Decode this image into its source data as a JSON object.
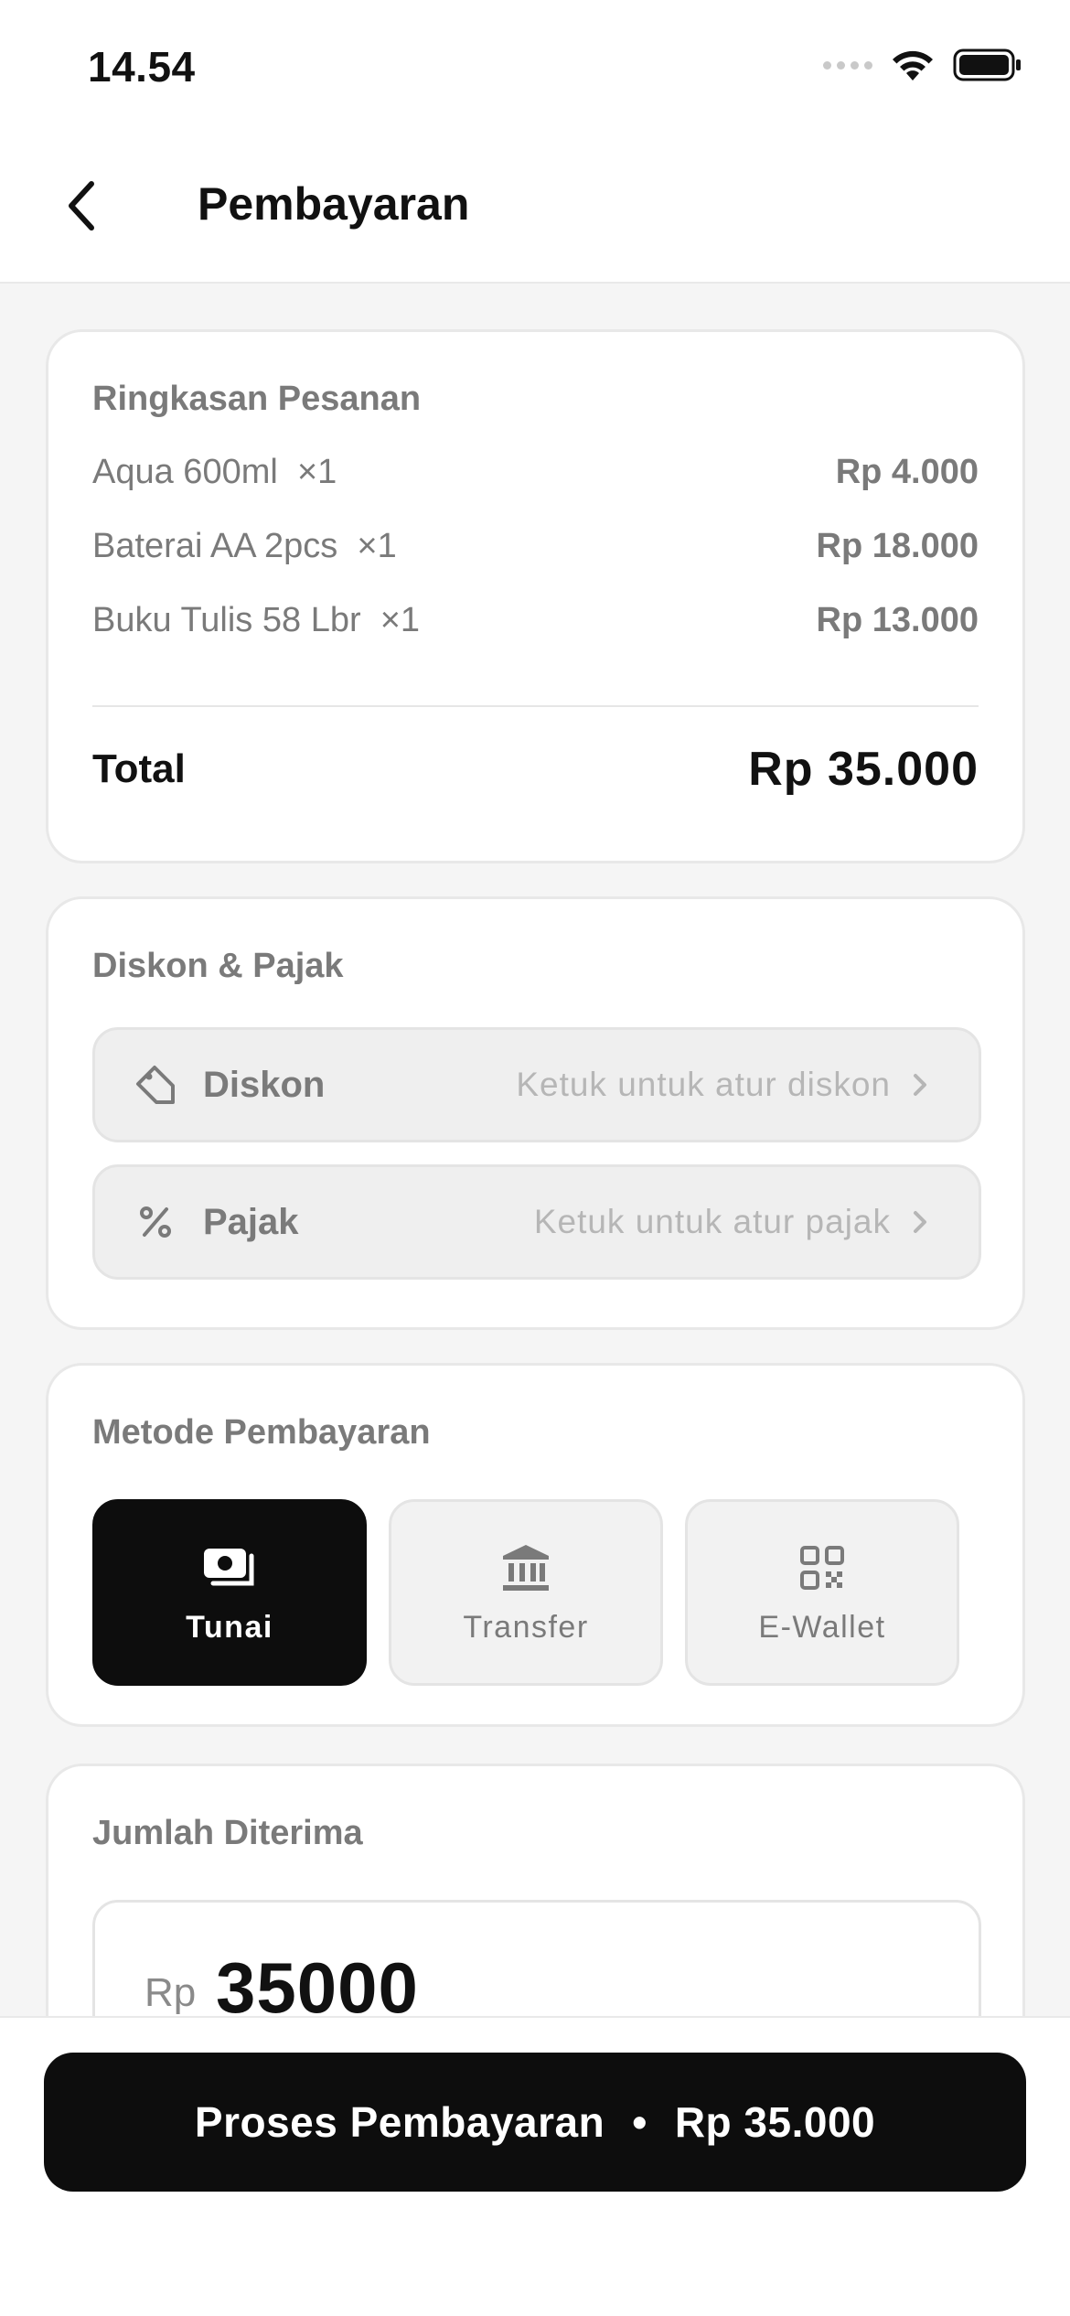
{
  "status": {
    "time": "14.54"
  },
  "header": {
    "title": "Pembayaran"
  },
  "order_summary": {
    "title": "Ringkasan Pesanan",
    "items": [
      {
        "name": "Aqua 600ml",
        "qty": "×1",
        "price": "Rp 4.000"
      },
      {
        "name": "Baterai AA 2pcs",
        "qty": "×1",
        "price": "Rp 18.000"
      },
      {
        "name": "Buku Tulis 58 Lbr",
        "qty": "×1",
        "price": "Rp 13.000"
      }
    ],
    "total_label": "Total",
    "total_value": "Rp 35.000"
  },
  "discount_tax": {
    "title": "Diskon & Pajak",
    "discount": {
      "label": "Diskon",
      "hint": "Ketuk untuk atur diskon",
      "icon": "tag-icon"
    },
    "tax": {
      "label": "Pajak",
      "hint": "Ketuk untuk atur pajak",
      "icon": "percent-icon"
    }
  },
  "payment_method": {
    "title": "Metode Pembayaran",
    "selected": "Tunai",
    "options": [
      {
        "label": "Tunai",
        "icon": "cash-icon"
      },
      {
        "label": "Transfer",
        "icon": "bank-icon"
      },
      {
        "label": "E-Wallet",
        "icon": "qr-code-icon"
      }
    ]
  },
  "amount_received": {
    "title": "Jumlah Diterima",
    "currency": "Rp",
    "value": "35000"
  },
  "cta": {
    "label": "Proses Pembayaran",
    "separator": "•",
    "amount": "Rp 35.000"
  },
  "colors": {
    "primary": "#0d0d0d",
    "background": "#f5f5f5",
    "muted_text": "#7a7a7a",
    "hint_text": "#b6b6b6"
  }
}
